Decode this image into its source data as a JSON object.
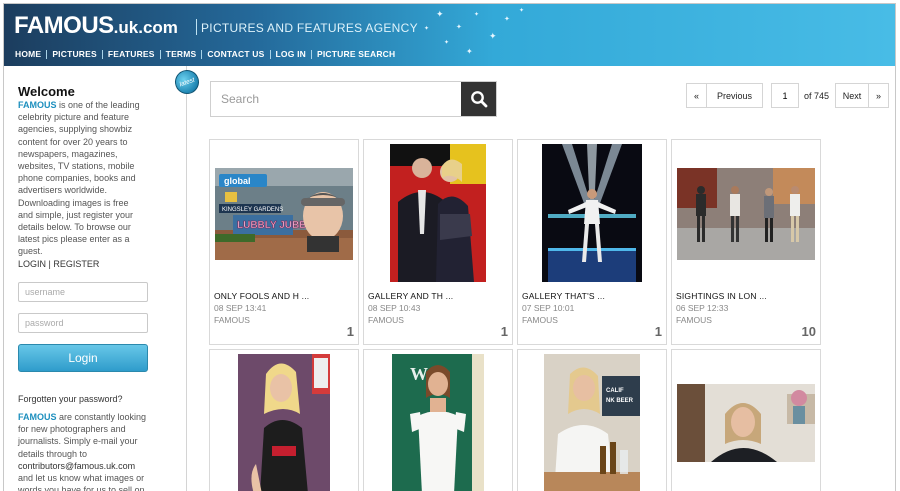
{
  "header": {
    "logo_main": "FAMOUS",
    "logo_suffix": ".uk.com",
    "tagline": "PICTURES AND FEATURES AGENCY",
    "nav": [
      "HOME",
      "PICTURES",
      "FEATURES",
      "TERMS",
      "CONTACT US",
      "LOG IN",
      "PICTURE SEARCH"
    ]
  },
  "sidebar": {
    "welcome_title": "Welcome",
    "brand": "FAMOUS",
    "welcome_text": " is one of the leading celebrity picture and feature agencies, supplying showbiz content for over 20 years to newspapers, magazines, websites, TV stations, mobile phone companies, books and advertisers worldwide. Downloading images is free and simple, just register your details below. To browse our latest pics please enter as a guest.",
    "login_link": "LOGIN",
    "auth_separator": "|",
    "register_link": "REGISTER",
    "username_placeholder": "username",
    "password_placeholder": "password",
    "login_button": "Login",
    "forgot_password": "Forgotten your password?",
    "contrib_brand": "FAMOUS",
    "contrib_text_before": " are constantly looking for new photographers and journalists. Simply e-mail your details through to ",
    "contrib_email": "contributors@famous.uk.com",
    "contrib_text_after": " and let us know what images or words you have for us to sell on"
  },
  "latest_badge": "latest",
  "search": {
    "placeholder": "Search"
  },
  "pagination": {
    "first": "«",
    "previous": "Previous",
    "current_page": "1",
    "of_label": "of 745",
    "next": "Next",
    "last": "»"
  },
  "cards": [
    {
      "title": "ONLY FOOLS AND H ...",
      "date": "08 SEP 13:41",
      "agency": "FAMOUS",
      "count": "1"
    },
    {
      "title": "GALLERY AND TH ...",
      "date": "08 SEP 10:43",
      "agency": "FAMOUS",
      "count": "1"
    },
    {
      "title": "GALLERY THAT'S ...",
      "date": "07 SEP 10:01",
      "agency": "FAMOUS",
      "count": "1"
    },
    {
      "title": "SIGHTINGS IN LON ...",
      "date": "06 SEP 12:33",
      "agency": "FAMOUS",
      "count": "10"
    },
    {
      "title": "",
      "date": "",
      "agency": "",
      "count": ""
    },
    {
      "title": "",
      "date": "",
      "agency": "",
      "count": ""
    },
    {
      "title": "",
      "date": "",
      "agency": "",
      "count": ""
    },
    {
      "title": "",
      "date": "",
      "agency": "",
      "count": ""
    }
  ],
  "thumbnail_texts": {
    "mural_brand": "global",
    "mural_sign": "KINGSLEY GARDENS",
    "mural_slogan": "LUBBLY JUBBLY"
  },
  "colors": {
    "header_dark": "#1c3d5e",
    "header_light": "#48bce6",
    "brand_link": "#1d8fbe",
    "login_button": "#2f9ccb",
    "search_button": "#333333"
  }
}
